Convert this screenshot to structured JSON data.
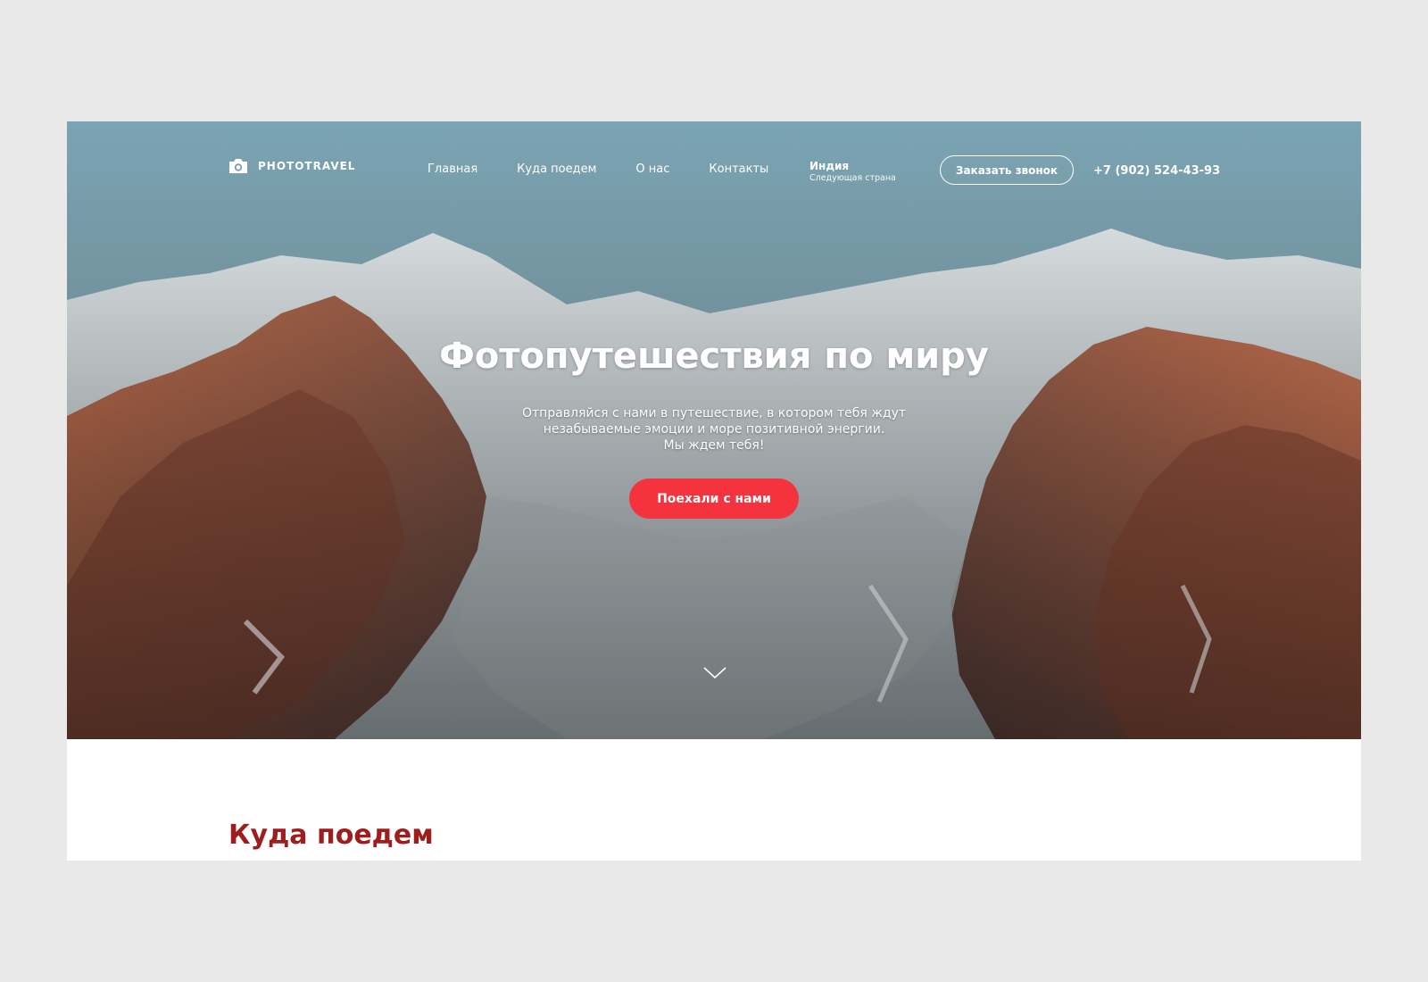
{
  "colors": {
    "page_bg": "#e9e9e9",
    "accent": "#f5333f",
    "section_title": "#9e1e1e",
    "text_light": "#ffffff"
  },
  "header": {
    "logo_text": "PHOTOTRAVEL",
    "logo_icon": "camera-icon",
    "nav": [
      {
        "label": "Главная"
      },
      {
        "label": "Куда поедем"
      },
      {
        "label": "О нас"
      },
      {
        "label": "Контакты"
      }
    ],
    "next_country": {
      "name": "Индия",
      "caption": "Следующая страна"
    },
    "call_button": "Заказать звонок",
    "phone": "+7 (902) 524-43-93"
  },
  "hero": {
    "title": "Фотопутешествия по миру",
    "subtitle_lines": [
      "Отправляйся с нами в путешествие, в котором тебя ждут",
      "незабываемые эмоции и море позитивной энергии.",
      "Мы ждем тебя!"
    ],
    "cta_label": "Поехали с нами",
    "scroll_icon": "chevron-down-icon"
  },
  "section": {
    "title": "Куда поедем"
  }
}
